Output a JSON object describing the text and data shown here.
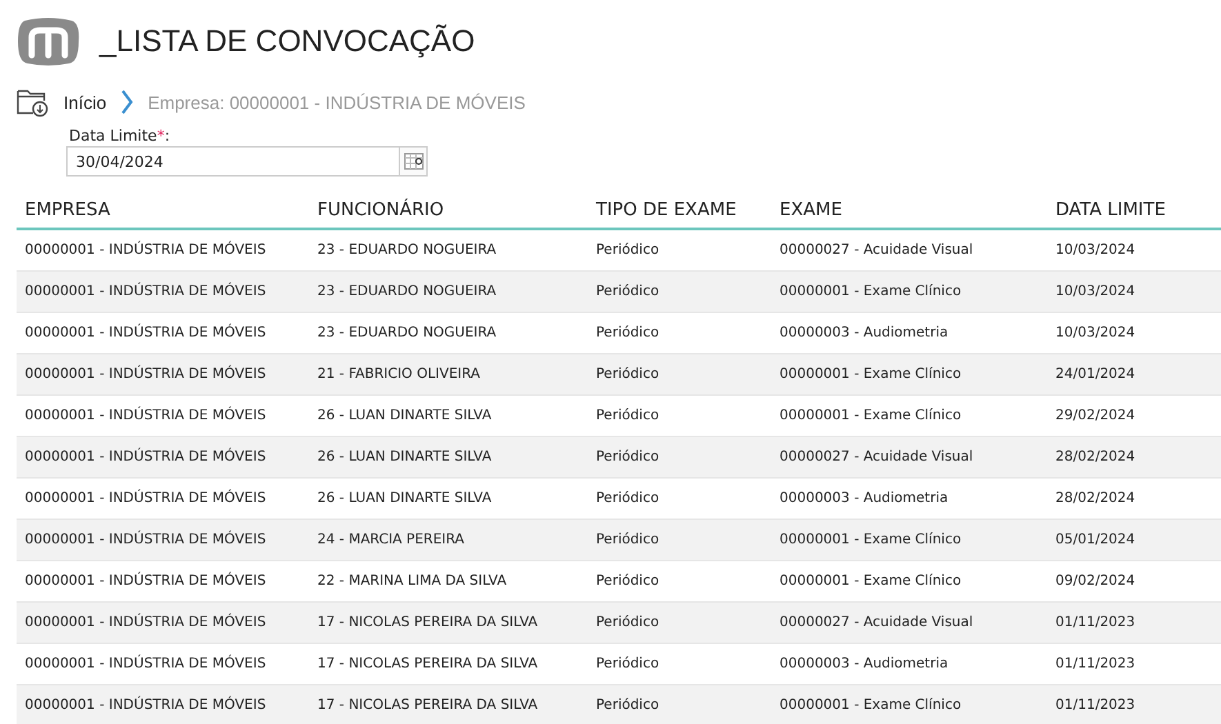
{
  "header": {
    "title": "_LISTA DE CONVOCAÇÃO"
  },
  "breadcrumb": [
    {
      "label": "Início"
    },
    {
      "label": "Empresa: 00000001 - INDÚSTRIA DE MÓVEIS"
    }
  ],
  "filter": {
    "label": "Data Limite",
    "required_mark": "*",
    "suffix": ":",
    "value": "30/04/2024"
  },
  "table": {
    "columns": [
      "EMPRESA",
      "FUNCIONÁRIO",
      "TIPO DE EXAME",
      "EXAME",
      "DATA LIMITE"
    ],
    "rows": [
      [
        "00000001 - INDÚSTRIA DE MÓVEIS",
        "23 - EDUARDO NOGUEIRA",
        "Periódico",
        "00000027 - Acuidade Visual",
        "10/03/2024"
      ],
      [
        "00000001 - INDÚSTRIA DE MÓVEIS",
        "23 - EDUARDO NOGUEIRA",
        "Periódico",
        "00000001 - Exame Clínico",
        "10/03/2024"
      ],
      [
        "00000001 - INDÚSTRIA DE MÓVEIS",
        "23 - EDUARDO NOGUEIRA",
        "Periódico",
        "00000003 - Audiometria",
        "10/03/2024"
      ],
      [
        "00000001 - INDÚSTRIA DE MÓVEIS",
        "21 - FABRICIO OLIVEIRA",
        "Periódico",
        "00000001 - Exame Clínico",
        "24/01/2024"
      ],
      [
        "00000001 - INDÚSTRIA DE MÓVEIS",
        "26 - LUAN DINARTE SILVA",
        "Periódico",
        "00000001 - Exame Clínico",
        "29/02/2024"
      ],
      [
        "00000001 - INDÚSTRIA DE MÓVEIS",
        "26 - LUAN DINARTE SILVA",
        "Periódico",
        "00000027 - Acuidade Visual",
        "28/02/2024"
      ],
      [
        "00000001 - INDÚSTRIA DE MÓVEIS",
        "26 - LUAN DINARTE SILVA",
        "Periódico",
        "00000003 - Audiometria",
        "28/02/2024"
      ],
      [
        "00000001 - INDÚSTRIA DE MÓVEIS",
        "24 - MARCIA PEREIRA",
        "Periódico",
        "00000001 - Exame Clínico",
        "05/01/2024"
      ],
      [
        "00000001 - INDÚSTRIA DE MÓVEIS",
        "22 - MARINA LIMA DA SILVA",
        "Periódico",
        "00000001 - Exame Clínico",
        "09/02/2024"
      ],
      [
        "00000001 - INDÚSTRIA DE MÓVEIS",
        "17 - NICOLAS PEREIRA DA SILVA",
        "Periódico",
        "00000027 - Acuidade Visual",
        "01/11/2023"
      ],
      [
        "00000001 - INDÚSTRIA DE MÓVEIS",
        "17 - NICOLAS PEREIRA DA SILVA",
        "Periódico",
        "00000003 - Audiometria",
        "01/11/2023"
      ],
      [
        "00000001 - INDÚSTRIA DE MÓVEIS",
        "17 - NICOLAS PEREIRA DA SILVA",
        "Periódico",
        "00000001 - Exame Clínico",
        "01/11/2023"
      ]
    ]
  }
}
